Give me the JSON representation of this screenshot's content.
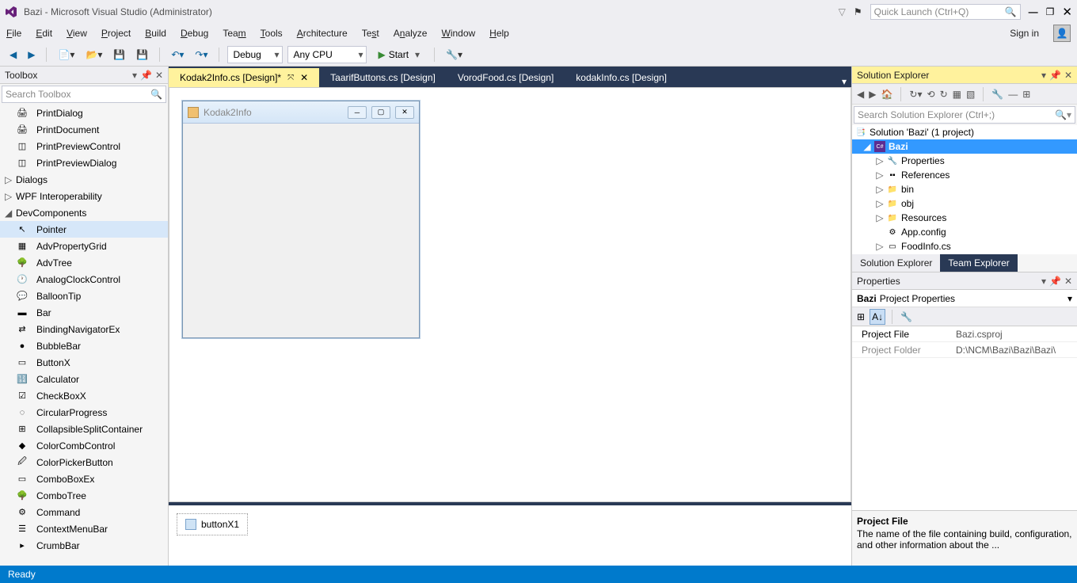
{
  "window": {
    "title": "Bazi - Microsoft Visual Studio (Administrator)",
    "quick_launch_placeholder": "Quick Launch (Ctrl+Q)"
  },
  "menu": {
    "items": [
      "File",
      "Edit",
      "View",
      "Project",
      "Build",
      "Debug",
      "Team",
      "Tools",
      "Architecture",
      "Test",
      "Analyze",
      "Window",
      "Help"
    ],
    "signin": "Sign in"
  },
  "toolbar": {
    "config": "Debug",
    "platform": "Any CPU",
    "start": "Start"
  },
  "toolbox": {
    "title": "Toolbox",
    "search_placeholder": "Search Toolbox",
    "items_top": [
      "PrintDialog",
      "PrintDocument",
      "PrintPreviewControl",
      "PrintPreviewDialog"
    ],
    "groups": [
      "Dialogs",
      "WPF Interoperability",
      "DevComponents"
    ],
    "pointer": "Pointer",
    "items_dev": [
      "AdvPropertyGrid",
      "AdvTree",
      "AnalogClockControl",
      "BalloonTip",
      "Bar",
      "BindingNavigatorEx",
      "BubbleBar",
      "ButtonX",
      "Calculator",
      "CheckBoxX",
      "CircularProgress",
      "CollapsibleSplitContainer",
      "ColorCombControl",
      "ColorPickerButton",
      "ComboBoxEx",
      "ComboTree",
      "Command",
      "ContextMenuBar",
      "CrumbBar"
    ]
  },
  "tabs": {
    "items": [
      {
        "label": "Kodak2Info.cs [Design]*",
        "active": true,
        "pinned": true,
        "closable": true
      },
      {
        "label": "TaarifButtons.cs [Design]",
        "active": false
      },
      {
        "label": "VorodFood.cs [Design]",
        "active": false
      },
      {
        "label": "kodakInfo.cs [Design]",
        "active": false
      }
    ]
  },
  "designer": {
    "form_title": "Kodak2Info",
    "component": "buttonX1"
  },
  "solution_explorer": {
    "title": "Solution Explorer",
    "search_placeholder": "Search Solution Explorer (Ctrl+;)",
    "root": "Solution 'Bazi' (1 project)",
    "project": "Bazi",
    "nodes": [
      "Properties",
      "References",
      "bin",
      "obj",
      "Resources",
      "App.config",
      "FoodInfo.cs"
    ],
    "tabs": [
      "Solution Explorer",
      "Team Explorer"
    ]
  },
  "properties": {
    "title": "Properties",
    "object": "Bazi",
    "object_type": "Project Properties",
    "rows": [
      {
        "name": "Project File",
        "value": "Bazi.csproj"
      },
      {
        "name": "Project Folder",
        "value": "D:\\NCM\\Bazi\\Bazi\\Bazi\\"
      }
    ],
    "desc_title": "Project File",
    "desc_text": "The name of the file containing build, configuration, and other information about the ..."
  },
  "status": {
    "text": "Ready"
  }
}
